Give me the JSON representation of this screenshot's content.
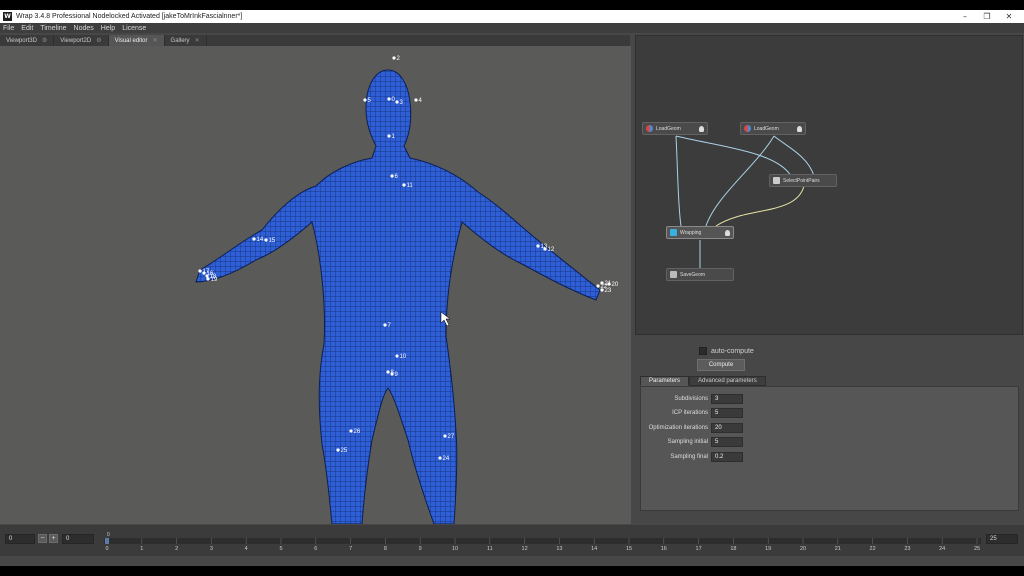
{
  "window": {
    "title": "Wrap 3.4.8 Professional Nodelocked Activated [jakeToMrInkFascialnner*]",
    "logo_text": "W",
    "controls": {
      "minimize": "–",
      "maximize": "❐",
      "close": "✕"
    }
  },
  "menu": [
    "File",
    "Edit",
    "Timeline",
    "Nodes",
    "Help",
    "License"
  ],
  "tabs": [
    {
      "label": "Viewport3D",
      "active": false
    },
    {
      "label": "Viewport2D",
      "active": false
    },
    {
      "label": "Visual editor",
      "active": true
    },
    {
      "label": "Gallery",
      "active": false
    }
  ],
  "viewport": {
    "mesh_color": "#2f5fd6",
    "points": [
      "2",
      "5",
      "0",
      "3",
      "4",
      "1",
      "6",
      "11",
      "14",
      "15",
      "17",
      "16",
      "18",
      "19",
      "13",
      "12",
      "21",
      "20",
      "22",
      "23",
      "7",
      "10",
      "8",
      "9",
      "26",
      "25",
      "27",
      "24"
    ]
  },
  "nodes": {
    "load1": "LoadGeom",
    "load2": "LoadGeom",
    "select": "SelectPointPairs",
    "wrapping": "Wrapping",
    "save": "SaveGeom"
  },
  "properties": {
    "auto_compute_label": "auto-compute",
    "auto_compute_checked": false,
    "compute_label": "Compute",
    "tabs": [
      {
        "label": "Parameters",
        "active": true
      },
      {
        "label": "Advanced parameters",
        "active": false
      }
    ],
    "params": [
      {
        "label": "Subdivisions",
        "value": "3"
      },
      {
        "label": "ICP iterations",
        "value": "5"
      },
      {
        "label": "Optimization iterations",
        "value": "20"
      },
      {
        "label": "Sampling initial",
        "value": "5"
      },
      {
        "label": "Sampling final",
        "value": "0.2"
      }
    ]
  },
  "timeline": {
    "current_frame": "0",
    "minus": "−",
    "plus": "+",
    "start_frame": "0",
    "end_frame": "25",
    "marker_label": "0",
    "ticks": [
      "0",
      "1",
      "2",
      "3",
      "4",
      "5",
      "6",
      "7",
      "8",
      "9",
      "10",
      "11",
      "12",
      "13",
      "14",
      "15",
      "16",
      "17",
      "18",
      "19",
      "20",
      "21",
      "22",
      "23",
      "24",
      "25"
    ]
  }
}
